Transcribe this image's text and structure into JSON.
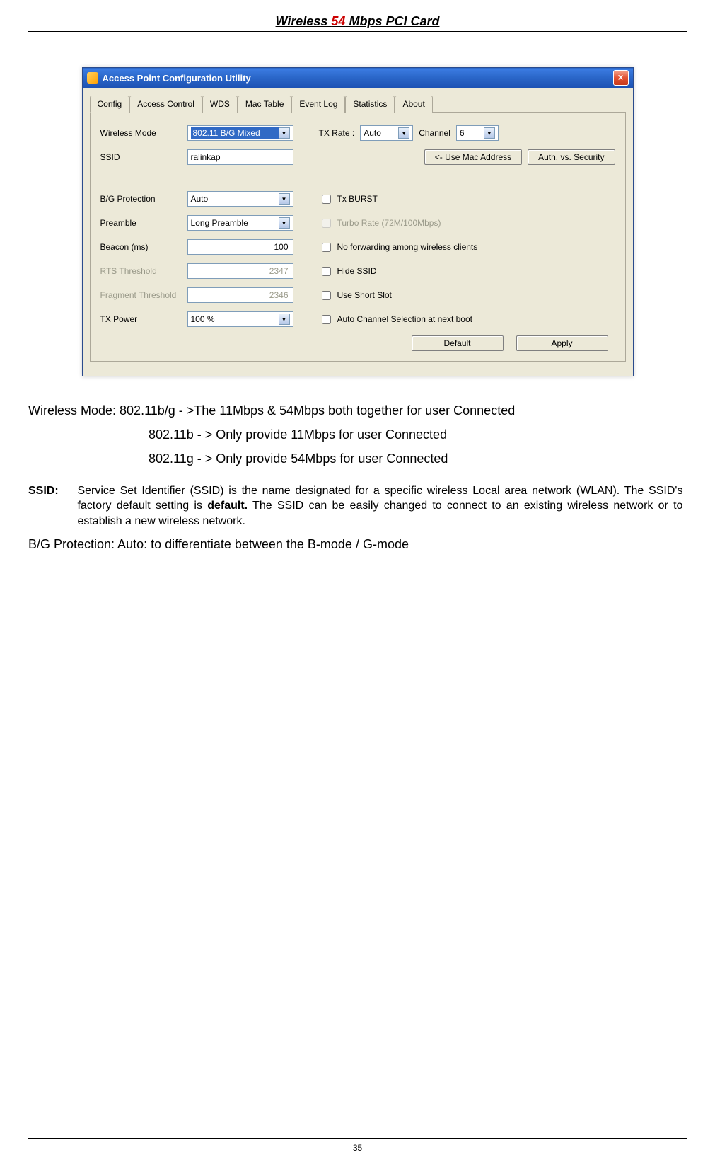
{
  "header": {
    "pre": "Wireless ",
    "red": "54",
    "post": " Mbps PCI Card"
  },
  "window": {
    "title": "Access Point Configuration Utility",
    "close_glyph": "×",
    "tabs": [
      "Config",
      "Access Control",
      "WDS",
      "Mac Table",
      "Event Log",
      "Statistics",
      "About"
    ],
    "labels": {
      "wireless_mode": "Wireless Mode",
      "tx_rate": "TX Rate :",
      "channel": "Channel",
      "ssid": "SSID",
      "use_mac": "<- Use Mac Address",
      "auth_sec": "Auth. vs. Security",
      "bg_prot": "B/G Protection",
      "preamble": "Preamble",
      "beacon": "Beacon (ms)",
      "rts": "RTS Threshold",
      "frag": "Fragment Threshold",
      "tx_power": "TX Power",
      "tx_burst": "Tx BURST",
      "turbo": "Turbo Rate (72M/100Mbps)",
      "no_fwd": "No forwarding among wireless clients",
      "hide_ssid": "Hide SSID",
      "use_short": "Use Short Slot",
      "auto_channel": "Auto Channel Selection at next boot",
      "default_btn": "Default",
      "apply_btn": "Apply"
    },
    "values": {
      "wireless_mode": "802.11 B/G Mixed",
      "tx_rate": "Auto",
      "channel": "6",
      "ssid": "ralinkap",
      "bg_prot": "Auto",
      "preamble": "Long Preamble",
      "beacon": "100",
      "rts": "2347",
      "frag": "2346",
      "tx_power": "100 %"
    }
  },
  "body": {
    "wm_line1_a": "Wireless Mode:  802.11b/g - >The 11Mbps & 54Mbps both together for user Connected",
    "wm_line2": "802.11b    - > Only provide 11Mbps  for user Connected",
    "wm_line3": "802.11g    - > Only provide 54Mbps  for user Connected",
    "ssid_label": "SSID:",
    "ssid_text_pre": "Service Set Identifier (SSID) is the name designated for a specific wireless Local area network (WLAN). The SSID's factory default setting is ",
    "ssid_bold": "default.",
    "ssid_text_post": " The SSID can be easily changed to connect to an existing wireless network or to establish a new wireless network.",
    "bg_prot": "B/G Protection:  Auto: to differentiate between the B-mode / G-mode"
  },
  "page_number": "35"
}
